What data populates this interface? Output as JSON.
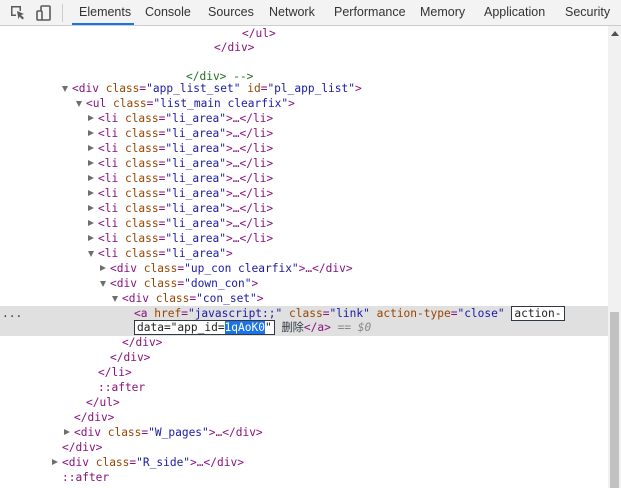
{
  "toolbar": {
    "icons": [
      "inspect-element-icon",
      "device-toolbar-icon"
    ],
    "tabs": [
      "Elements",
      "Console",
      "Sources",
      "Network",
      "Performance",
      "Memory",
      "Application",
      "Security"
    ],
    "active_tab": "Elements",
    "accent": "#1a73e8"
  },
  "tree": {
    "l1": "</ul>",
    "l2": "</div>",
    "l3": "</div> -->",
    "l4": {
      "tag": "div",
      "attrs": [
        [
          "class",
          "\"app_list_set\""
        ],
        [
          "id",
          "\"pl_app_list\""
        ]
      ]
    },
    "l5": {
      "tag": "ul",
      "attrs": [
        [
          "class",
          "\"list_main clearfix\""
        ]
      ]
    },
    "li_collapsed": {
      "open": "<li ",
      "attr": "class",
      "eq": "=",
      "val": "\"li_area\"",
      "close": ">…</li>"
    },
    "l15": {
      "tag": "li",
      "attrs": [
        [
          "class",
          "\"li_area\""
        ]
      ]
    },
    "l16": {
      "tag": "div",
      "class": "\"up_con clearfix\"",
      "tail": ">…</div>"
    },
    "l17": {
      "tag": "div",
      "attrs": [
        [
          "class",
          "\"down_con\""
        ]
      ]
    },
    "l18": {
      "tag": "div",
      "attrs": [
        [
          "class",
          "\"con_set\""
        ]
      ]
    },
    "selected": {
      "ellipsis": "...",
      "tag": "a",
      "href_attr": "href",
      "href_val": "\"javascript:;\"",
      "class_attr": "class",
      "class_val": "\"link\"",
      "type_attr": "action-type",
      "type_val": "\"close\"",
      "edit_line1": "action-",
      "edit_line2_pre": "data=\"app_id=",
      "edit_highlight": "1qAoK0",
      "edit_line2_post": "\"",
      "text": "删除",
      "close_tag": "</a>",
      "dollar": " == $0"
    },
    "l20": "</div>",
    "l21": "</div>",
    "l22": "</li>",
    "l23": "::after",
    "l24": "</ul>",
    "l25": "</div>",
    "l26": {
      "tag": "div",
      "class": "\"W_pages\"",
      "tail": ">…</div>"
    },
    "l27": "</div>",
    "l28": {
      "tag": "div",
      "class": "\"R_side\"",
      "tail": ">…</div>"
    },
    "l29": "::after"
  }
}
